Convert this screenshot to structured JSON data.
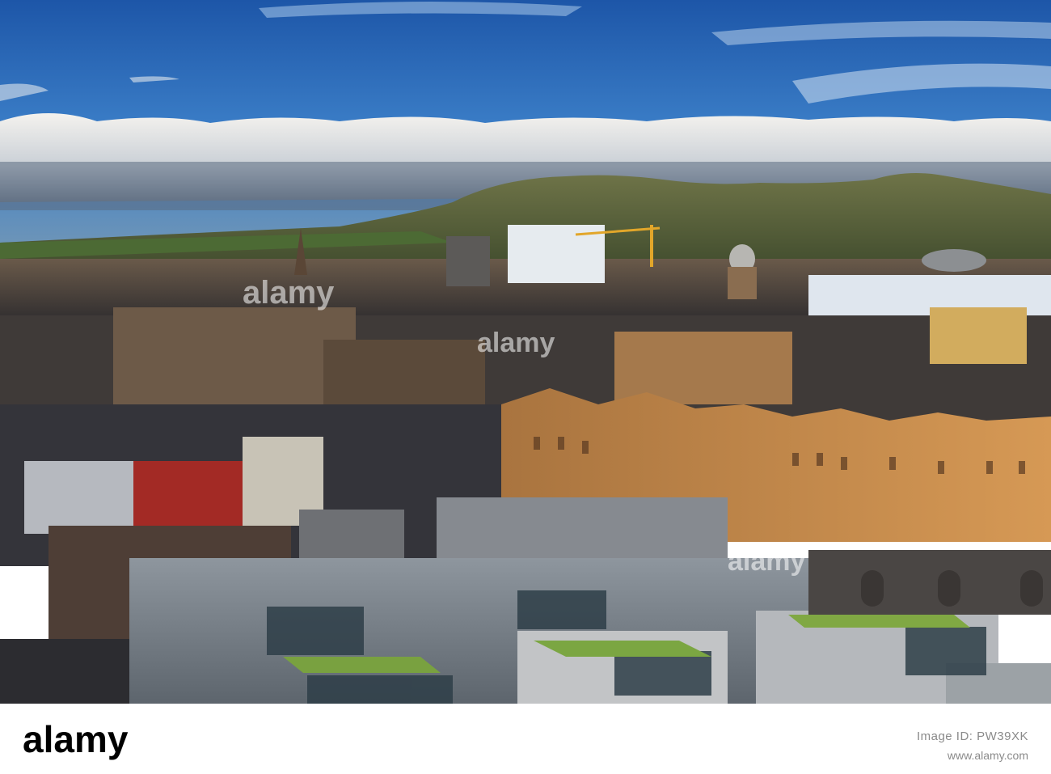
{
  "watermark": {
    "brand": "alamy",
    "stock_id": "PW39XK",
    "url": "www.alamy.com"
  },
  "scene": {
    "sky_top": "#1f5fb0",
    "sky_mid": "#3a7ec9",
    "cloud": "#e8eef4",
    "hill": "#55633a",
    "sunlit_stone": "#c98a4a",
    "shadow_stone": "#3b3a3c",
    "green_roof": "#7aa03c"
  }
}
